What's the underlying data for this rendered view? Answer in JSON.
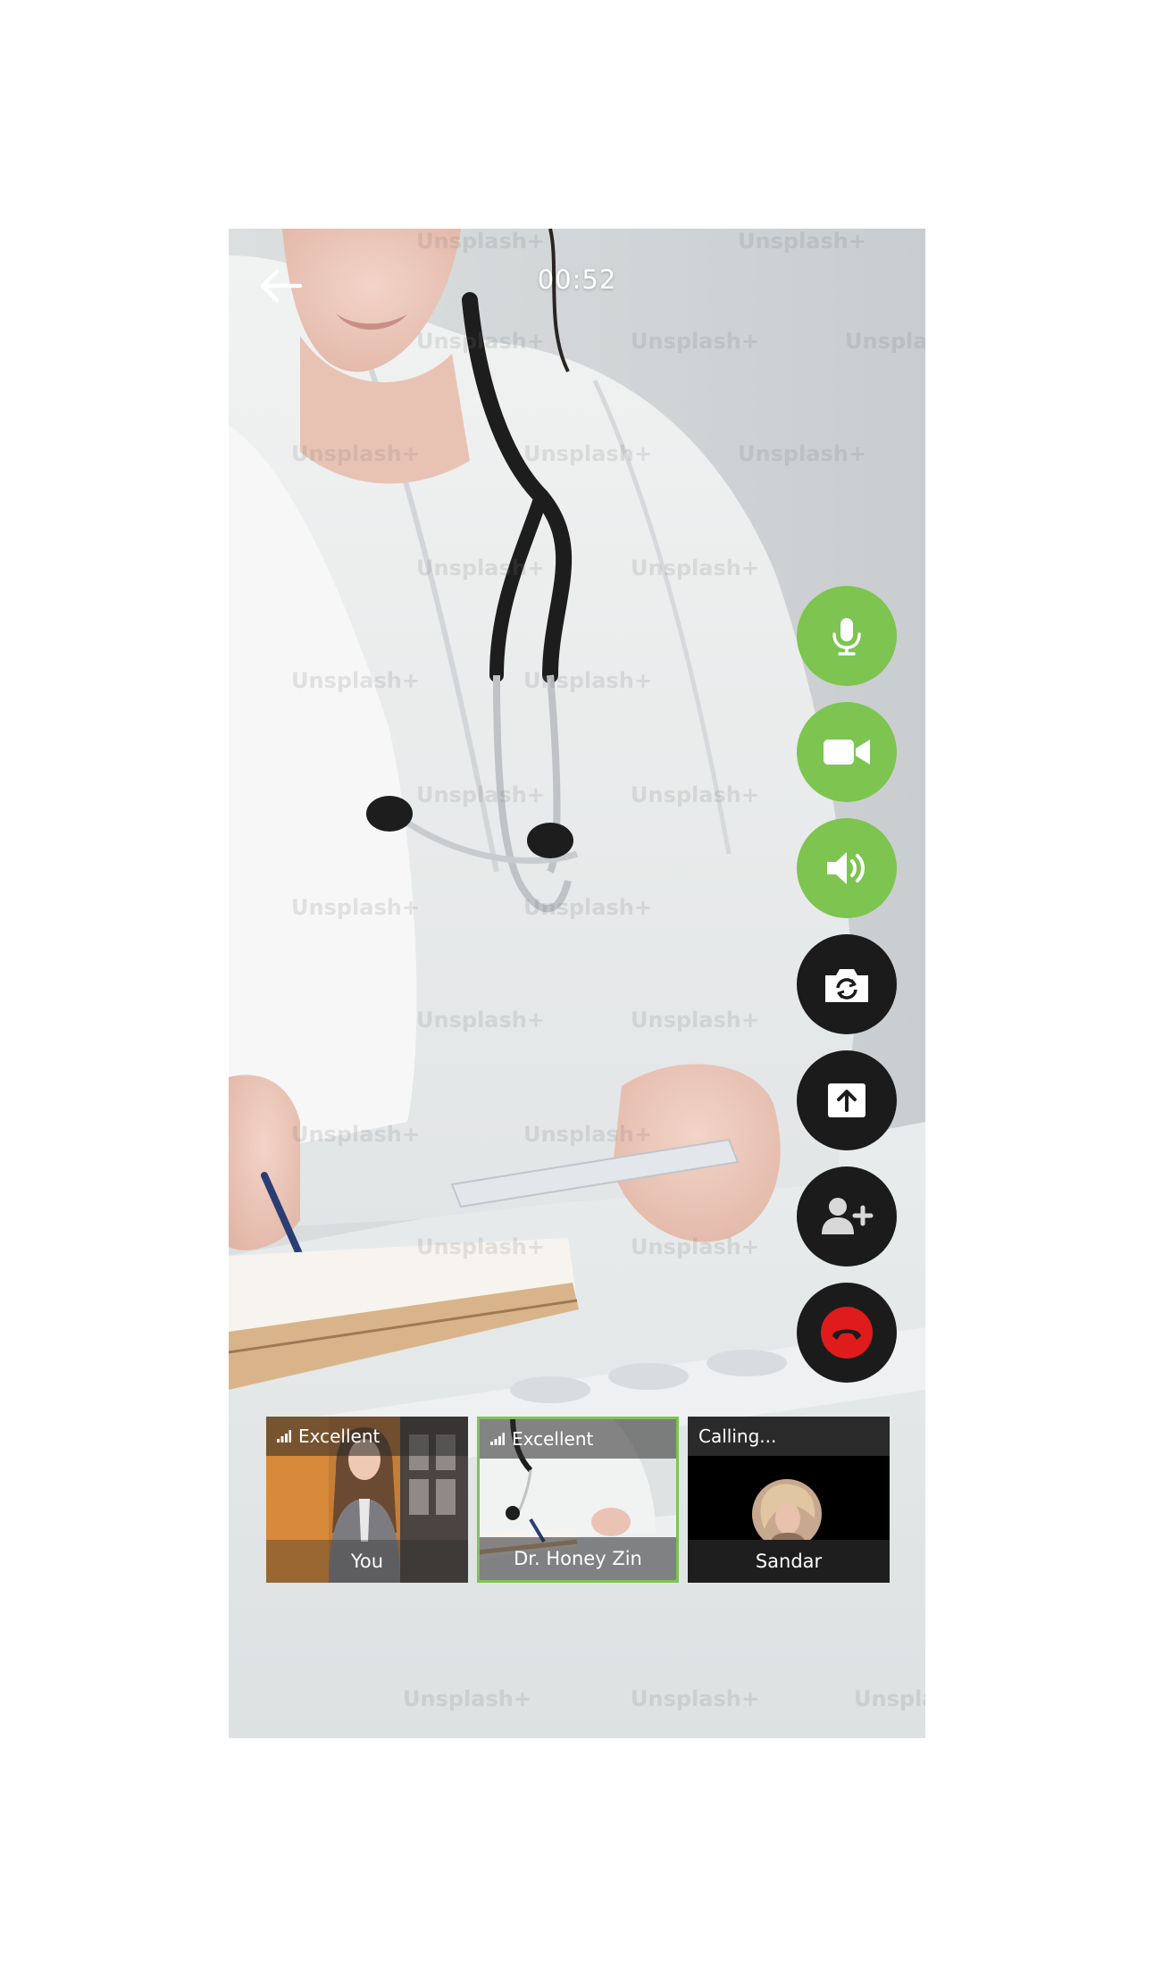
{
  "call": {
    "timer": "00:52",
    "watermark_text": "Unsplash+"
  },
  "controls": [
    {
      "name": "microphone",
      "icon": "microphone-icon",
      "style": "active"
    },
    {
      "name": "video",
      "icon": "video-camera-icon",
      "style": "active"
    },
    {
      "name": "speaker",
      "icon": "speaker-icon",
      "style": "active"
    },
    {
      "name": "switch-camera",
      "icon": "camera-switch-icon",
      "style": "neutral"
    },
    {
      "name": "share-screen",
      "icon": "share-screen-icon",
      "style": "neutral"
    },
    {
      "name": "add-participant",
      "icon": "add-user-icon",
      "style": "neutral"
    },
    {
      "name": "end-call",
      "icon": "hang-up-icon",
      "style": "danger"
    }
  ],
  "participants": [
    {
      "status": "Excellent",
      "name": "You",
      "selected": false
    },
    {
      "status": "Excellent",
      "name": "Dr. Honey Zin",
      "selected": true
    },
    {
      "status": "Calling...",
      "name": "Sandar",
      "selected": false
    }
  ],
  "colors": {
    "accent_green": "#7dc451",
    "control_dark": "#1b1b1b",
    "end_call_red": "#e01b1b",
    "selected_border": "#7dc451"
  }
}
